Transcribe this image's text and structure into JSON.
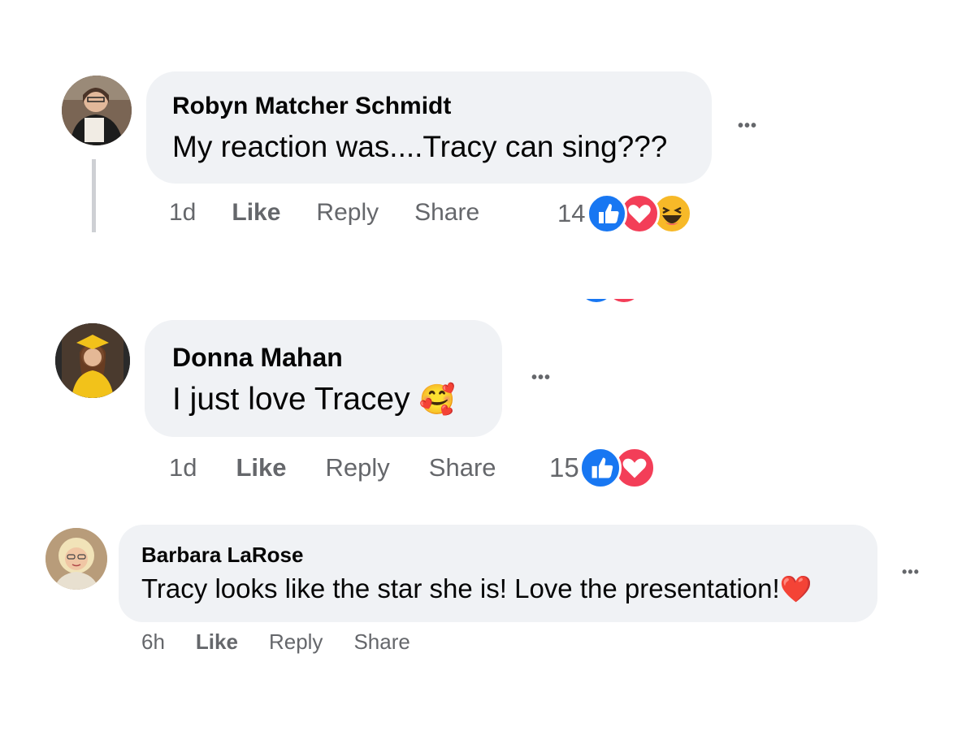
{
  "comments": [
    {
      "author": "Robyn Matcher Schmidt",
      "text": "My reaction was....Tracy can sing???",
      "time": "1d",
      "like": "Like",
      "reply": "Reply",
      "share": "Share",
      "more": "•••",
      "reaction_count": "14",
      "reactions": [
        "like-icon",
        "love-icon",
        "haha-icon"
      ]
    },
    {
      "author": "Donna Mahan",
      "text": "I just love Tracey",
      "emoji": "🥰",
      "time": "1d",
      "like": "Like",
      "reply": "Reply",
      "share": "Share",
      "more": "•••",
      "reaction_count": "15",
      "reactions": [
        "like-icon",
        "love-icon"
      ]
    },
    {
      "author": "Barbara LaRose",
      "text": "Tracy looks like the star she is! Love the presentation!",
      "emoji": "❤️",
      "time": "6h",
      "like": "Like",
      "reply": "Reply",
      "share": "Share",
      "more": "•••"
    }
  ],
  "colors": {
    "bubble": "#f0f2f5",
    "meta_text": "#65676b",
    "like_blue": "#1877f2",
    "love_red": "#f33e58",
    "haha_yellow": "#f7b928"
  }
}
